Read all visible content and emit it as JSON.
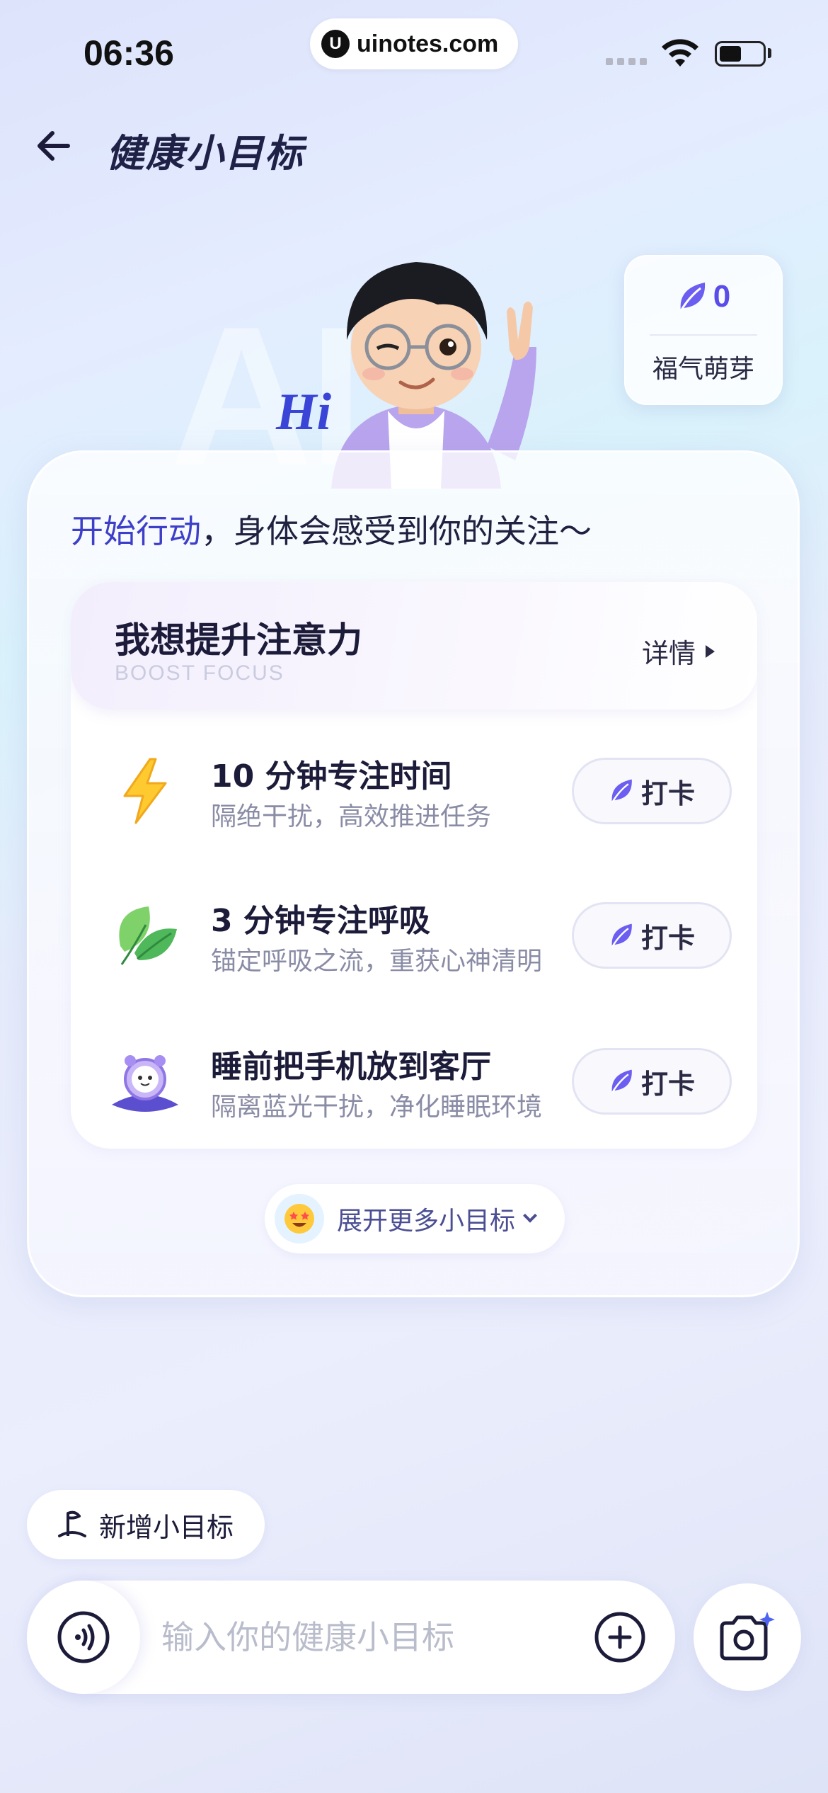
{
  "status_bar": {
    "time": "06:36",
    "url": "uinotes.com",
    "url_logo": "U"
  },
  "header": {
    "back_icon": "back-arrow-icon",
    "title": "健康小目标"
  },
  "hero": {
    "watermark": "AI",
    "greeting": "Hi",
    "points": {
      "value": "0",
      "label": "福气萌芽",
      "icon": "leaf-icon"
    }
  },
  "card": {
    "heading_highlight": "开始行动",
    "heading_rest": "，身体会感受到你的关注～",
    "goal": {
      "title": "我想提升注意力",
      "subtitle": "BOOST FOCUS",
      "detail_label": "详情"
    },
    "tasks": [
      {
        "icon": "lightning-icon",
        "title": "10 分钟专注时间",
        "desc": "隔绝干扰，高效推进任务",
        "button": "打卡"
      },
      {
        "icon": "leaf-green-icon",
        "title": "3 分钟专注呼吸",
        "desc": "锚定呼吸之流，重获心神清明",
        "button": "打卡"
      },
      {
        "icon": "alarm-clock-icon",
        "title": "睡前把手机放到客厅",
        "desc": "隔离蓝光干扰，净化睡眠环境",
        "button": "打卡"
      }
    ],
    "expand_label": "展开更多小目标"
  },
  "bottom": {
    "add_goal_label": "新增小目标",
    "input_placeholder": "输入你的健康小目标"
  },
  "colors": {
    "accent": "#5a4de8",
    "heading_highlight": "#3d3fc9",
    "text_primary": "#1c1c3a",
    "text_secondary": "#8a8ca6"
  }
}
